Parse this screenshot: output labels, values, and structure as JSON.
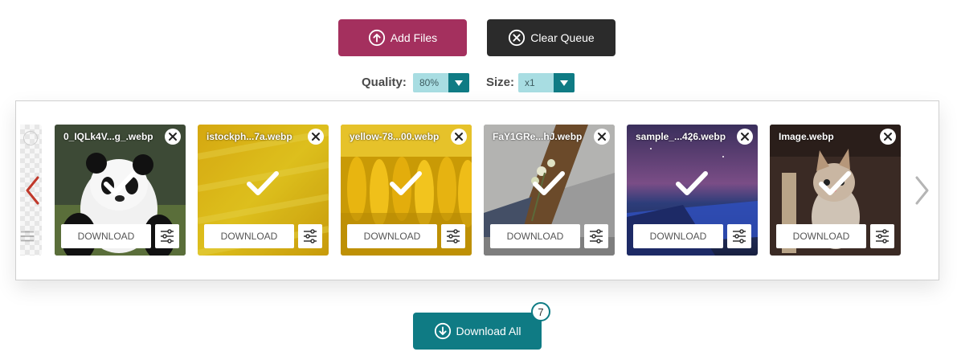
{
  "toolbar": {
    "add_files_label": "Add Files",
    "clear_queue_label": "Clear Queue"
  },
  "options": {
    "quality_label": "Quality:",
    "quality_value": "80%",
    "size_label": "Size:",
    "size_value": "x1"
  },
  "queue": {
    "files": [
      {
        "name": "0_IQLk4V...g_.webp",
        "download_label": "DOWNLOAD"
      },
      {
        "name": "istockph...7a.webp",
        "download_label": "DOWNLOAD"
      },
      {
        "name": "yellow-78...00.webp",
        "download_label": "DOWNLOAD"
      },
      {
        "name": "FaY1GRe...hJ.webp",
        "download_label": "DOWNLOAD"
      },
      {
        "name": "sample_...426.webp",
        "download_label": "DOWNLOAD"
      },
      {
        "name": "Image.webp",
        "download_label": "DOWNLOAD"
      }
    ]
  },
  "footer": {
    "download_all_label": "Download All",
    "count": "7"
  },
  "colors": {
    "add_files": "#a4305e",
    "clear_queue": "#2b2b2b",
    "accent": "#0f7b84",
    "prev_arrow": "#c0392b"
  }
}
